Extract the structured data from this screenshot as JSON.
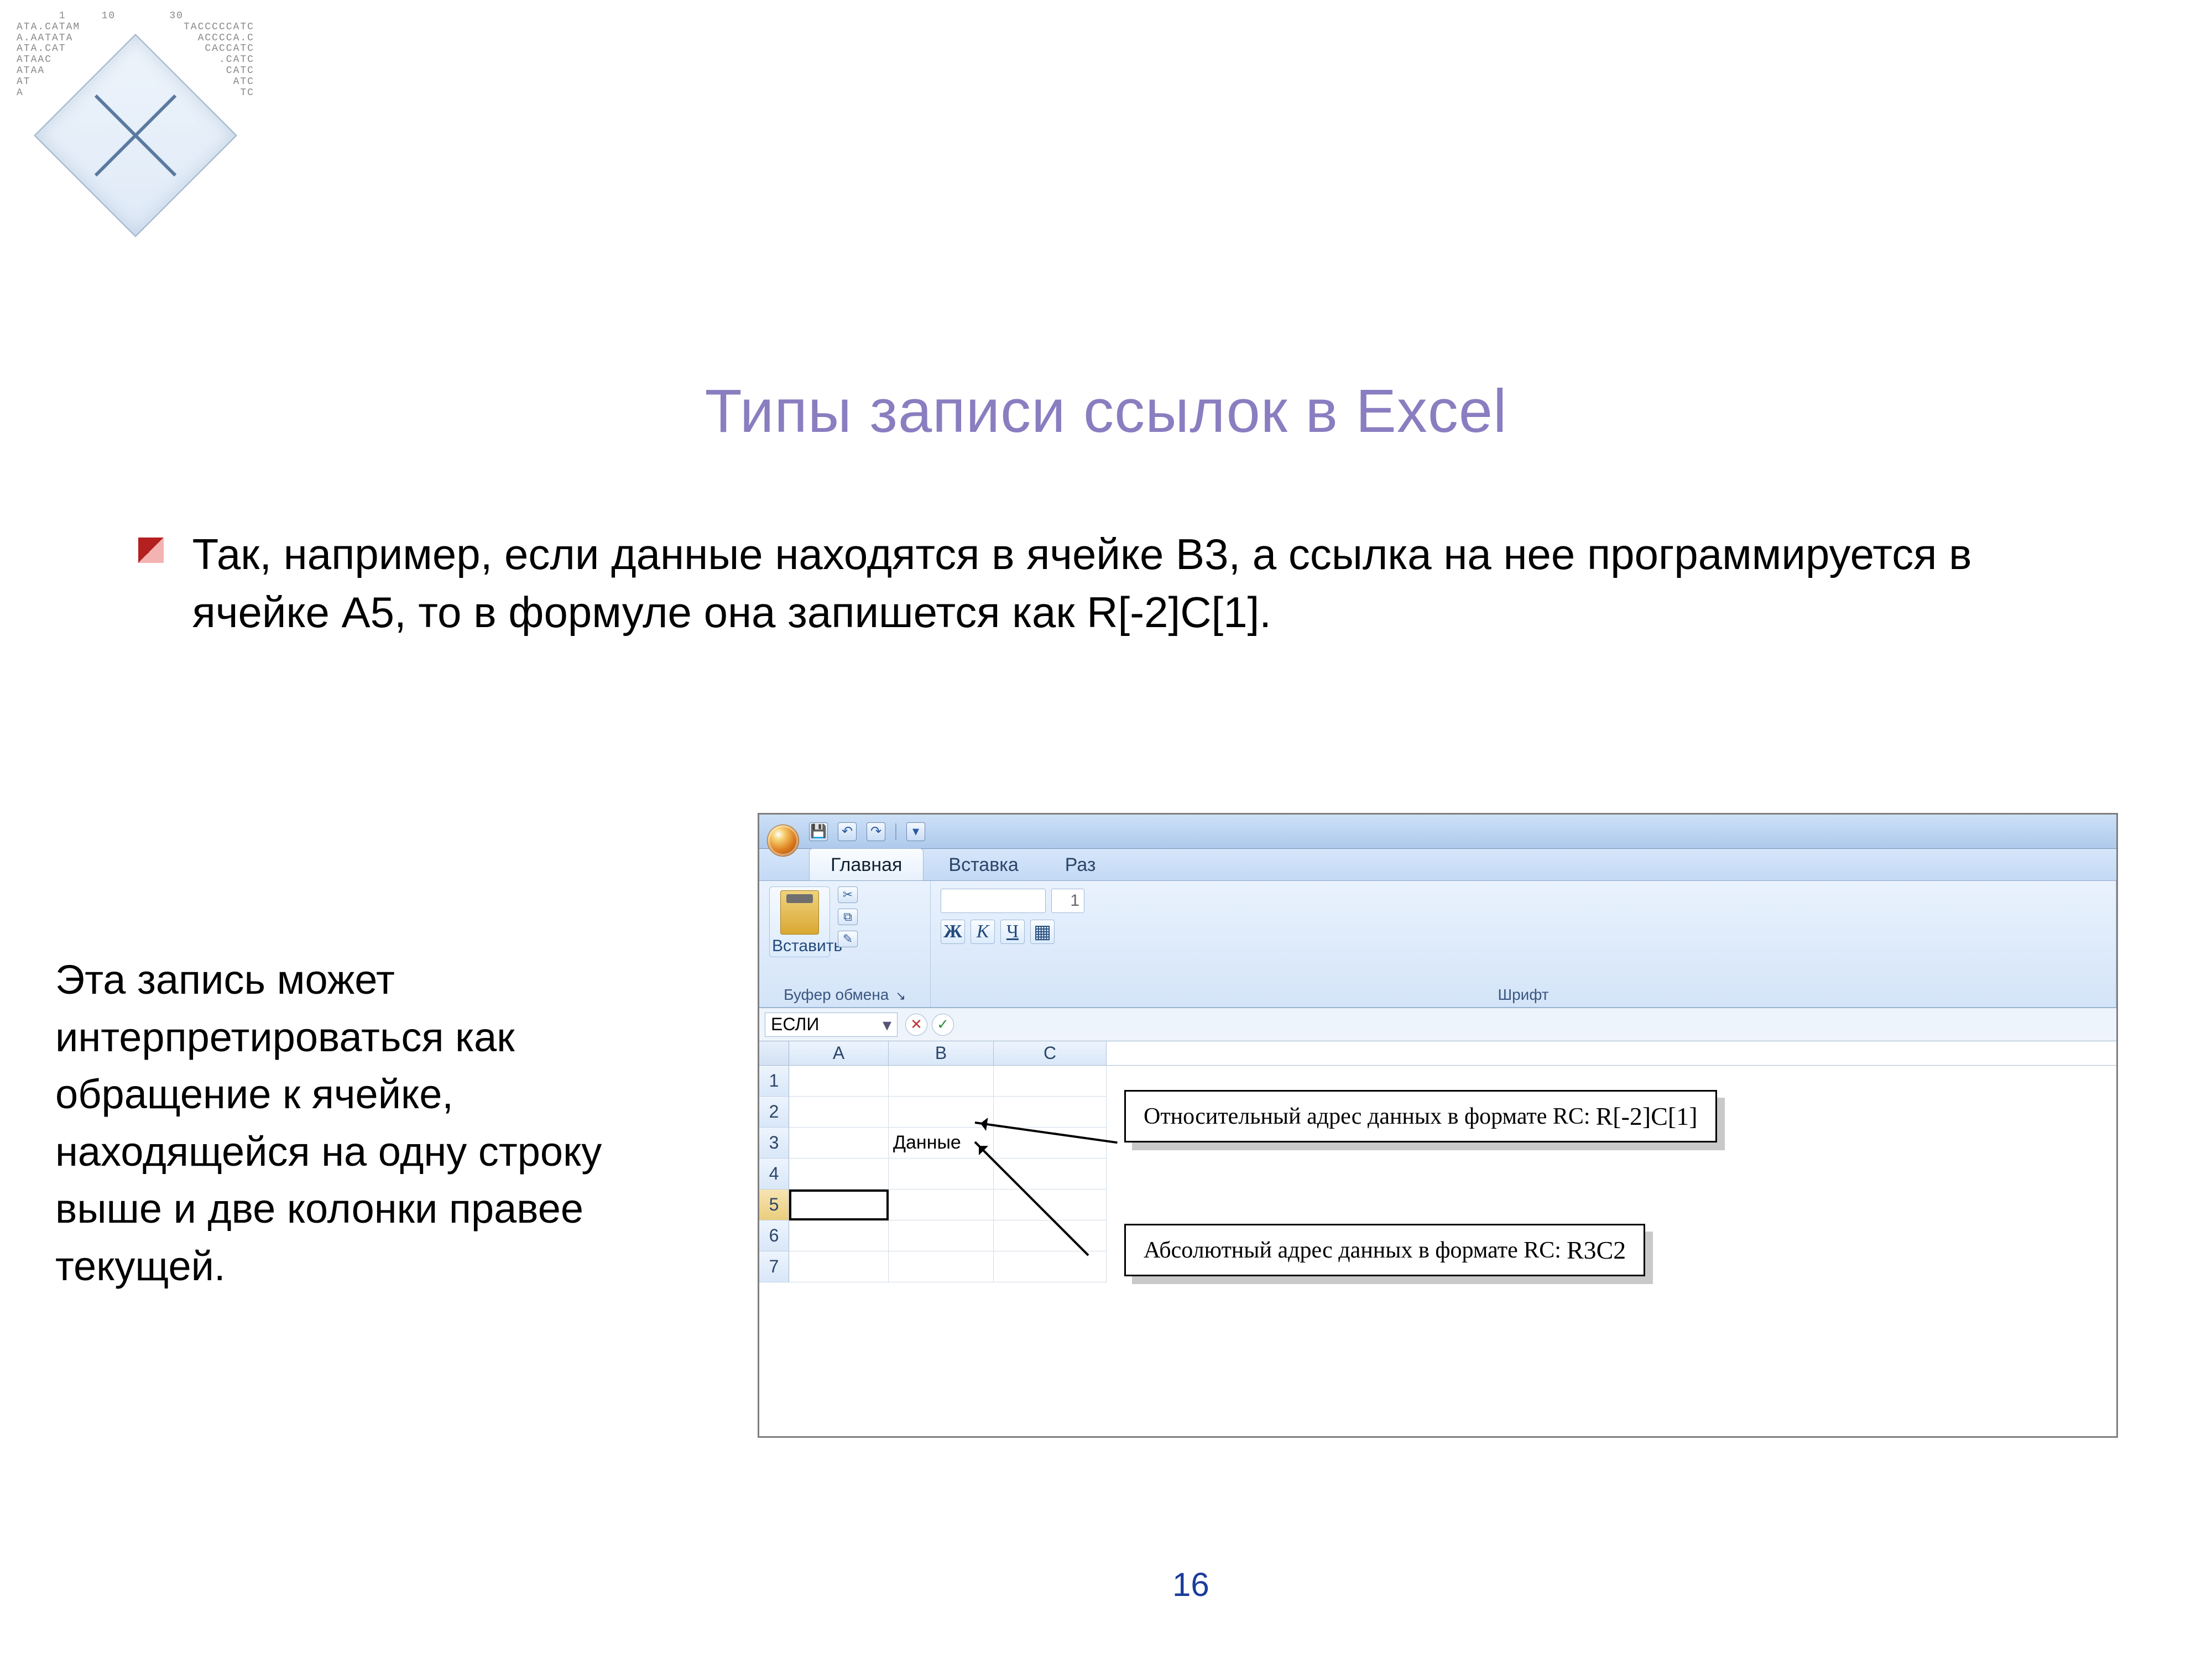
{
  "logo": {
    "seq_left": "      1     10\nATA.CATAM\nA.AATATA\nATA.CAT\nATAAC\nATAA\nAT\nA",
    "seq_right": "30          \nTACCCCCATC\n  ACCCCA.C\n   CACCATC\n     .CATC\n      CATC\n       ATC\n        TC"
  },
  "slide": {
    "title": "Типы записи ссылок в Excel",
    "bullet": "Так, например, если данные находятся в ячейке B3, а ссылка на нее программируется в ячейке A5, то в формуле она запишется как R[-2]C[1].",
    "note": "Эта запись может интерпретироваться как обращение к ячейке, находящейся на одну строку выше и две колонки правее текущей.",
    "page_number": "16"
  },
  "figure": {
    "qat": {
      "save_icon": "💾",
      "undo_icon": "↶",
      "redo_icon": "↷",
      "custom_icon": "▾"
    },
    "tabs": {
      "home": "Главная",
      "insert": "Вставка",
      "third_partial": "Раз"
    },
    "clipboard": {
      "paste_label": "Вставить",
      "group_label": "Буфер обмена",
      "cut_icon": "✂",
      "copy_icon": "⧉",
      "fmt_icon": "✎"
    },
    "font": {
      "group_label": "Шрифт",
      "name_value": "",
      "size_value": "1",
      "bold": "Ж",
      "italic": "К",
      "underline": "Ч"
    },
    "namebox": {
      "value": "ЕСЛИ",
      "dropdown": "▾"
    },
    "fx": {
      "cancel": "✕",
      "ok": "✓"
    },
    "grid": {
      "cols": [
        "A",
        "B",
        "C"
      ],
      "rows": [
        "1",
        "2",
        "3",
        "4",
        "5",
        "6",
        "7"
      ],
      "b3_value": "Данные",
      "a5_value": "="
    },
    "callouts": {
      "rel_prefix": "Относительный адрес данных в формате RC: ",
      "rel_rc": "R[-2]C[1]",
      "abs_prefix": "Абсолютный адрес данных в формате RC: ",
      "abs_rc": "R3C2"
    }
  }
}
